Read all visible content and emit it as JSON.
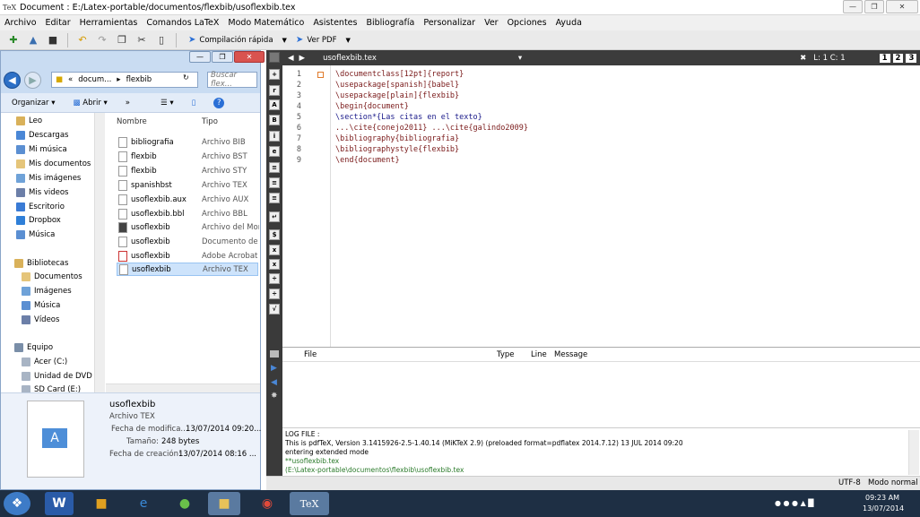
{
  "window": {
    "title": "Document : E:/Latex-portable/documentos/flexbib/usoflexbib.tex",
    "tex_logo": "TeX"
  },
  "menu": [
    "Archivo",
    "Editar",
    "Herramientas",
    "Comandos LaTeX",
    "Modo Matemático",
    "Asistentes",
    "Bibliografía",
    "Personalizar",
    "Ver",
    "Opciones",
    "Ayuda"
  ],
  "toolbar": {
    "compile_label": "Compilación rápida",
    "view_label": "Ver PDF"
  },
  "explorer": {
    "breadcrumb": [
      "docum...",
      "flexbib"
    ],
    "search_placeholder": "Buscar flex...",
    "cmd": {
      "organize": "Organizar",
      "open": "Abrir"
    },
    "nav": {
      "favorites": [
        "Leo",
        "Descargas",
        "Mi música",
        "Mis documentos",
        "Mis imágenes",
        "Mis videos",
        "Escritorio",
        "Dropbox",
        "Música"
      ],
      "libraries_title": "Bibliotecas",
      "libraries": [
        "Documentos",
        "Imágenes",
        "Música",
        "Vídeos"
      ],
      "computer_title": "Equipo",
      "drives": [
        "Acer (C:)",
        "Unidad de DVD",
        "SD Card (E:)"
      ]
    },
    "columns": {
      "name": "Nombre",
      "type": "Tipo"
    },
    "files": [
      {
        "name": "bibliografia",
        "type": "Archivo BIB"
      },
      {
        "name": "flexbib",
        "type": "Archivo BST"
      },
      {
        "name": "flexbib",
        "type": "Archivo STY"
      },
      {
        "name": "spanishbst",
        "type": "Archivo TEX"
      },
      {
        "name": "usoflexbib.aux",
        "type": "Archivo AUX"
      },
      {
        "name": "usoflexbib.bbl",
        "type": "Archivo BBL"
      },
      {
        "name": "usoflexbib",
        "type": "Archivo del Mon"
      },
      {
        "name": "usoflexbib",
        "type": "Documento de t"
      },
      {
        "name": "usoflexbib",
        "type": "Adobe Acrobat ..."
      },
      {
        "name": "usoflexbib",
        "type": "Archivo TEX"
      }
    ],
    "details": {
      "name": "usoflexbib",
      "type": "Archivo TEX",
      "mod_label": "Fecha de modifica...",
      "mod_value": "13/07/2014 09:20...",
      "size_label": "Tamaño:",
      "size_value": "248 bytes",
      "created_label": "Fecha de creación:",
      "created_value": "13/07/2014 08:16 ..."
    }
  },
  "editor": {
    "tab": "usoflexbib.tex",
    "cursor": "L: 1 C: 1",
    "views": [
      "1",
      "2",
      "3"
    ],
    "lines": [
      "\\documentclass[12pt]{report}",
      "\\usepackage[spanish]{babel}",
      "\\usepackage[plain]{flexbib}",
      "\\begin{document}",
      "\\section*{Las citas en el texto}",
      "...\\cite{conejo2011} ...\\cite{galindo2009}",
      "\\bibliography{bibliografia}",
      "\\bibliographystyle{flexbib}",
      "\\end{document}"
    ]
  },
  "messages": {
    "cols": [
      "File",
      "Type",
      "Line",
      "Message"
    ]
  },
  "log": {
    "title": "LOG FILE :",
    "lines": [
      "This is pdfTeX, Version 3.1415926-2.5-1.40.14 (MiKTeX 2.9) (preloaded format=pdflatex 2014.7.12) 13 JUL 2014 09:20",
      "entering extended mode",
      "**usoflexbib.tex",
      "(E:\\Latex-portable\\documentos\\flexbib\\usoflexbib.tex"
    ]
  },
  "status": {
    "encoding": "UTF-8",
    "mode": "Modo normal"
  },
  "taskbar": {
    "time": "09:23 AM",
    "date": "13/07/2014"
  }
}
